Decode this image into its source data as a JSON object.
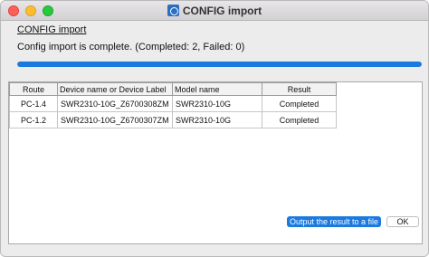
{
  "window": {
    "title": "CONFIG import"
  },
  "dialog": {
    "heading": "CONFIG import",
    "status": "Config import is complete. (Completed: 2, Failed: 0)",
    "progress_fraction": 1.0,
    "accent_color": "#1a7ae0"
  },
  "table": {
    "columns": [
      "Route",
      "Device name or Device Label",
      "Model name",
      "Result"
    ],
    "rows": [
      {
        "route": "PC-1.4",
        "device": "SWR2310-10G_Z6700308ZM",
        "model": "SWR2310-10G",
        "result": "Completed"
      },
      {
        "route": "PC-1.2",
        "device": "SWR2310-10G_Z6700307ZM",
        "model": "SWR2310-10G",
        "result": "Completed"
      }
    ]
  },
  "buttons": {
    "export_label": "Output the result to a file",
    "ok_label": "OK"
  }
}
